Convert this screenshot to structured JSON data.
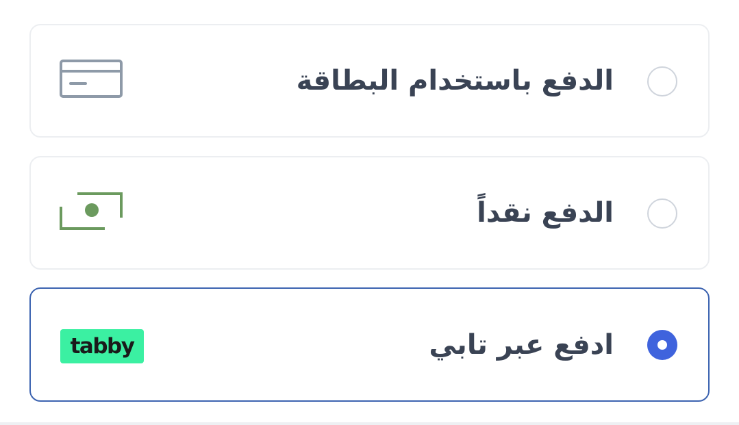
{
  "payment_options": {
    "card": {
      "label": "الدفع باستخدام البطاقة",
      "icon": "credit-card-icon",
      "selected": false
    },
    "cash": {
      "label": "الدفع نقداً",
      "icon": "cash-icon",
      "selected": false
    },
    "tabby": {
      "label": "ادفع عبر تابي",
      "logo_text": "tabby",
      "selected": true
    }
  },
  "colors": {
    "selected_border": "#3c63b0",
    "radio_checked": "#3f63dd",
    "card_icon": "#8e9aa8",
    "cash_icon": "#6b9a5e",
    "tabby_logo_bg": "#3bf0a2",
    "label_text": "#3a4354"
  }
}
